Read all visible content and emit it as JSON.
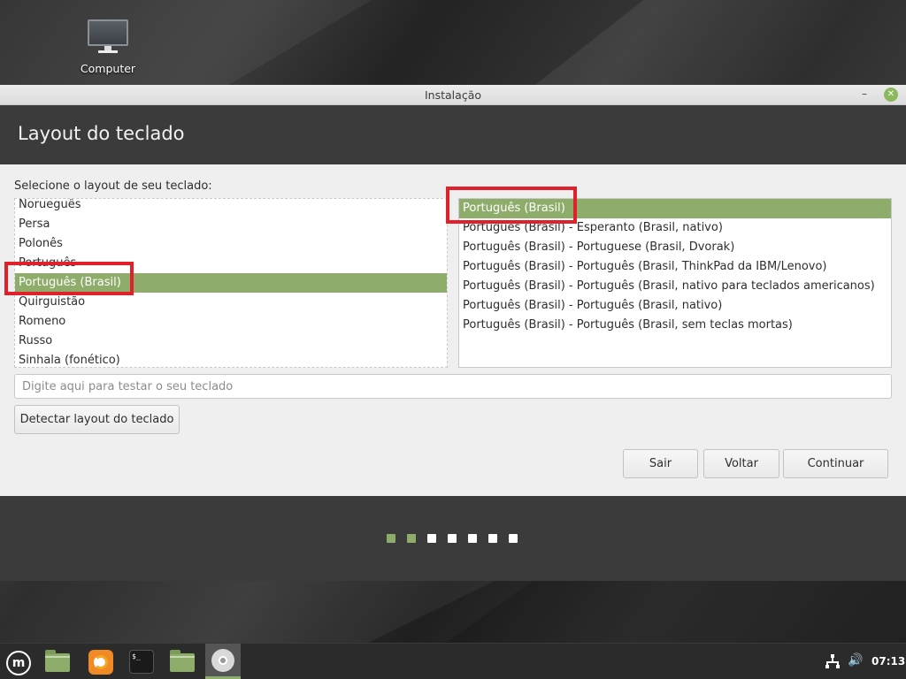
{
  "desktop": {
    "icon_label": "Computer"
  },
  "window": {
    "title": "Instalação",
    "minimize_glyph": "–",
    "close_glyph": "✕"
  },
  "header": {
    "title": "Layout do teclado"
  },
  "content": {
    "prompt": "Selecione o layout de seu teclado:",
    "languages": [
      "Norueguês",
      "Persa",
      "Polonês",
      "Português",
      "Português (Brasil)",
      "Quirguistão",
      "Romeno",
      "Russo",
      "Sinhala (fonético)"
    ],
    "languages_selected_index": 4,
    "variants": [
      "Português (Brasil)",
      "Português (Brasil) - Esperanto (Brasil, nativo)",
      "Português (Brasil) - Portuguese (Brasil, Dvorak)",
      "Português (Brasil) - Português (Brasil, ThinkPad da IBM/Lenovo)",
      "Português (Brasil) - Português (Brasil, nativo para teclados americanos)",
      "Português (Brasil) - Português (Brasil, nativo)",
      "Português (Brasil) - Português (Brasil, sem teclas mortas)"
    ],
    "variants_selected_index": 0,
    "test_placeholder": "Digite aqui para testar o seu teclado",
    "detect_button": "Detectar layout do teclado"
  },
  "actions": {
    "quit": "Sair",
    "back": "Voltar",
    "continue": "Continuar"
  },
  "progress": {
    "total_steps": 7,
    "completed_steps": 2
  },
  "taskbar": {
    "menu_glyph": "m",
    "terminal_glyph": "$_",
    "volume_glyph": "🔊",
    "clock": "07:13"
  },
  "colors": {
    "accent": "#8fad6a",
    "annotation": "#e0202a",
    "header_bg": "#3b3b3b"
  }
}
